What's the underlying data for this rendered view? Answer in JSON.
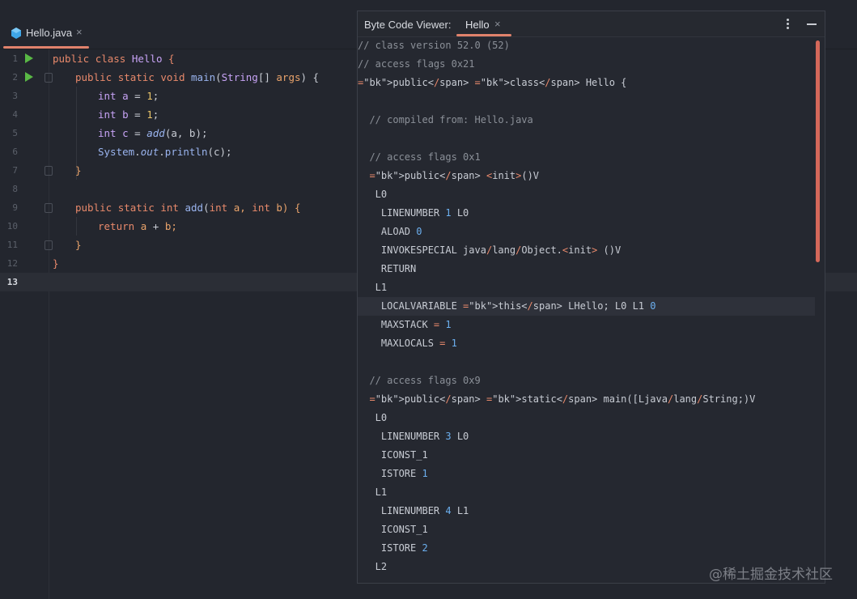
{
  "editor": {
    "tab": {
      "label": "Hello.java",
      "close": "×"
    },
    "current_line": 13
  },
  "code_lines": [
    {
      "n": "1"
    },
    {
      "n": "2"
    },
    {
      "n": "3"
    },
    {
      "n": "4"
    },
    {
      "n": "5"
    },
    {
      "n": "6"
    },
    {
      "n": "7"
    },
    {
      "n": "8"
    },
    {
      "n": "9"
    },
    {
      "n": "10"
    },
    {
      "n": "11"
    },
    {
      "n": "12"
    },
    {
      "n": "13"
    }
  ],
  "code": {
    "l1": [
      "public",
      "class",
      "Hello",
      "{"
    ],
    "l2": [
      "public",
      "static",
      "void",
      "main",
      "(",
      "String",
      "[] ",
      "args",
      ") {"
    ],
    "l3": [
      "int",
      "a",
      "=",
      "1",
      ";"
    ],
    "l4": [
      "int",
      "b",
      "=",
      "1",
      ";"
    ],
    "l5": [
      "int",
      "c",
      "=",
      "add",
      "(a, b);"
    ],
    "l6": [
      "System",
      ".",
      "out",
      ".",
      "println",
      "(c);"
    ],
    "l7": [
      "}"
    ],
    "l9": [
      "public",
      "static",
      "int",
      "add",
      "(",
      "int",
      "a,",
      "int",
      "b) {"
    ],
    "l10": [
      "return",
      "a",
      "+",
      "b;"
    ],
    "l11": [
      "}"
    ],
    "l12": [
      "}"
    ]
  },
  "bytecode_viewer": {
    "title": "Byte Code Viewer:",
    "tab": "Hello",
    "close": "×",
    "lines": [
      "// class version 52.0 (52)",
      "// access flags 0x21",
      "public class Hello {",
      "",
      "  // compiled from: Hello.java",
      "",
      "  // access flags 0x1",
      "  public <init>()V",
      "   L0",
      "    LINENUMBER 1 L0",
      "    ALOAD 0",
      "    INVOKESPECIAL java/lang/Object.<init> ()V",
      "    RETURN",
      "   L1",
      "    LOCALVARIABLE this LHello; L0 L1 0",
      "    MAXSTACK = 1",
      "    MAXLOCALS = 1",
      "",
      "  // access flags 0x9",
      "  public static main([Ljava/lang/String;)V",
      "   L0",
      "    LINENUMBER 3 L0",
      "    ICONST_1",
      "    ISTORE 1",
      "   L1",
      "    LINENUMBER 4 L1",
      "    ICONST_1",
      "    ISTORE 2",
      "   L2"
    ],
    "highlighted_line": 15
  },
  "watermark": "@稀土掘金技术社区",
  "colors": {
    "accent": "#e0826c",
    "run": "#59b845",
    "background": "#23262e"
  }
}
